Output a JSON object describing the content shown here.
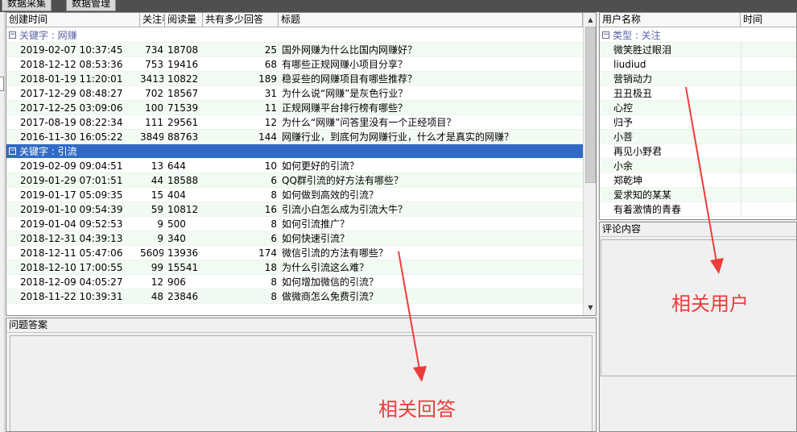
{
  "topbar": {
    "tabs": [
      "数据采集",
      "数据管理"
    ]
  },
  "question_grid": {
    "columns": [
      "创建时间",
      "关注者",
      "阅读量",
      "共有多少回答",
      "标题"
    ],
    "groups": [
      {
        "label": "关键字 : 网赚",
        "selected": false,
        "rows": [
          [
            "2019-02-07 10:37:45",
            "734",
            "18708",
            "25",
            "国外网赚为什么比国内网赚好？"
          ],
          [
            "2018-12-12 08:53:36",
            "753",
            "19416",
            "68",
            "有哪些正规网赚小项目分享？"
          ],
          [
            "2018-01-19 11:20:01",
            "3413",
            "10822",
            "189",
            "稳妥些的网赚项目有哪些推荐？"
          ],
          [
            "2017-12-29 08:48:27",
            "702",
            "18567",
            "31",
            "为什么说“网赚”是灰色行业？"
          ],
          [
            "2017-12-25 03:09:06",
            "100",
            "71539",
            "11",
            "正规网赚平台排行榜有哪些？"
          ],
          [
            "2017-08-19 08:22:34",
            "111",
            "29561",
            "12",
            "为什么“网赚”问答里没有一个正经项目？"
          ],
          [
            "2016-11-30 16:05:22",
            "3849",
            "88763",
            "144",
            "网赚行业，到底何为网赚行业，什么才是真实的网赚？"
          ]
        ]
      },
      {
        "label": "关键字 : 引流",
        "selected": true,
        "rows": [
          [
            "2019-02-09 09:04:51",
            "13",
            "644",
            "10",
            "如何更好的引流？"
          ],
          [
            "2019-01-29 07:01:51",
            "44",
            "18588",
            "6",
            "QQ群引流的好方法有哪些？"
          ],
          [
            "2019-01-17 05:09:35",
            "15",
            "404",
            "8",
            "如何做到高效的引流？"
          ],
          [
            "2019-01-10 09:54:39",
            "59",
            "10812",
            "16",
            "引流小白怎么成为引流大牛？"
          ],
          [
            "2019-01-04 09:52:53",
            "9",
            "500",
            "8",
            "如何引流推广？"
          ],
          [
            "2018-12-31 04:39:13",
            "9",
            "340",
            "6",
            "如何快速引流？"
          ],
          [
            "2018-12-11 05:47:06",
            "5609",
            "13936",
            "174",
            "微信引流的方法有哪些？"
          ],
          [
            "2018-12-10 17:00:55",
            "99",
            "15541",
            "18",
            "为什么引流这么难？"
          ],
          [
            "2018-12-09 04:05:27",
            "12",
            "906",
            "8",
            "如何增加微信的引流？"
          ],
          [
            "2018-11-22 10:39:31",
            "48",
            "23846",
            "8",
            "做微商怎么免费引流？"
          ]
        ]
      }
    ]
  },
  "answer_panel": {
    "title": "问题答案"
  },
  "user_grid": {
    "columns": [
      "用户名称",
      "时间"
    ],
    "group_label": "类型 : 关注",
    "users": [
      "微笑胜过眼泪",
      "liudiud",
      "营销动力",
      "丑丑极丑",
      "心控",
      "归予",
      "小菩",
      "再见小野君",
      "小余",
      "郑乾坤",
      "爱求知的某某",
      "有着激情的青春"
    ]
  },
  "comment_panel": {
    "title": "评论内容"
  },
  "annotations": {
    "answers": "相关回答",
    "users": "相关用户",
    "color": "#ee3b3b"
  }
}
